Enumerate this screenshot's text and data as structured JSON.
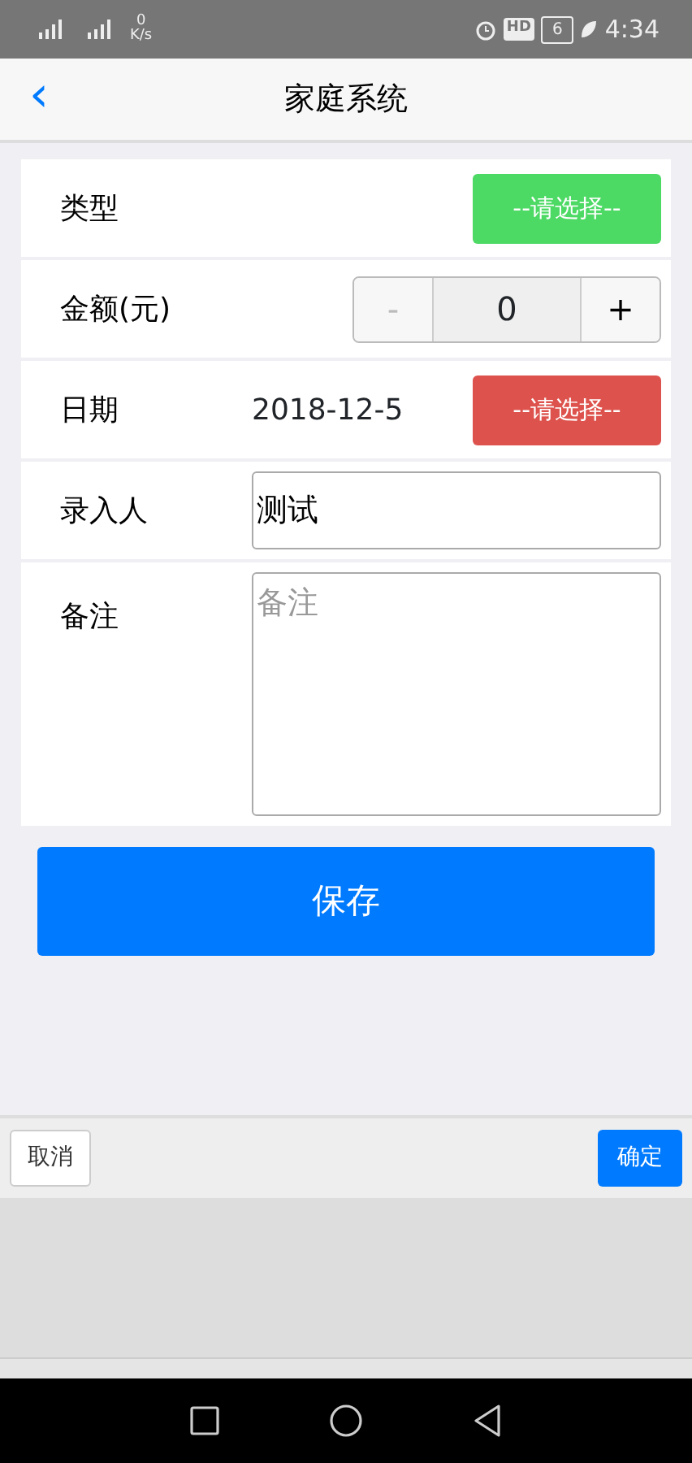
{
  "status_bar": {
    "speed_value": "0",
    "speed_unit": "K/s",
    "hd": "HD",
    "battery": "6",
    "time": "4:34"
  },
  "header": {
    "back": "‹",
    "title": "家庭系统"
  },
  "form": {
    "rows": [
      {
        "kind": "select",
        "label": "类型",
        "button": "--请选择--",
        "color": "#4cd964"
      },
      {
        "kind": "stepper",
        "label": "金额(元)",
        "minus": "-",
        "value": "0",
        "plus": "+",
        "minus_disabled": true
      },
      {
        "kind": "date",
        "label": "日期",
        "value": "2018-12-5",
        "button": "--请选择--",
        "color": "#dd524d"
      },
      {
        "kind": "input",
        "label": "录入人",
        "value": "测试"
      },
      {
        "kind": "textarea",
        "label": "备注",
        "placeholder": "备注"
      }
    ]
  },
  "save_button": "保存",
  "picker": {
    "cancel": "取消",
    "confirm": "确定"
  }
}
